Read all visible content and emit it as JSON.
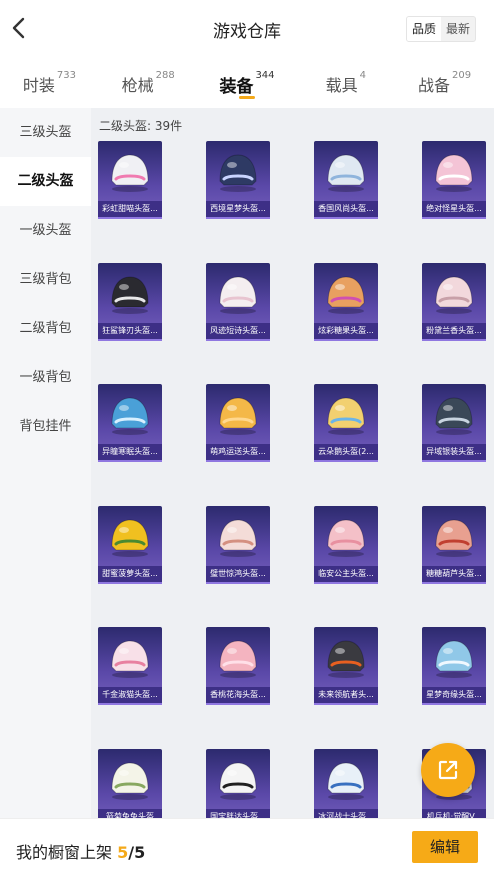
{
  "header": {
    "title": "游戏仓库",
    "sort_options": [
      "品质",
      "最新"
    ],
    "sort_active": 0
  },
  "tabs": [
    {
      "label": "时装",
      "count": "733"
    },
    {
      "label": "枪械",
      "count": "288"
    },
    {
      "label": "装备",
      "count": "344",
      "active": true
    },
    {
      "label": "载具",
      "count": "4"
    },
    {
      "label": "战备",
      "count": "209"
    }
  ],
  "sidebar": {
    "items": [
      "三级头盔",
      "二级头盔",
      "一级头盔",
      "三级背包",
      "二级背包",
      "一级背包",
      "背包挂件"
    ],
    "active": 1
  },
  "main": {
    "count_label": "二级头盔: 39件"
  },
  "items": [
    {
      "label": "彩虹甜喵头盔...",
      "color": "#f0f0f4",
      "accent": "#f07ab0"
    },
    {
      "label": "西境星梦头盔...",
      "color": "#2e3a64",
      "accent": "#c9d4ff"
    },
    {
      "label": "香国风尚头盔...",
      "color": "#dfe8f2",
      "accent": "#8fb4dc"
    },
    {
      "label": "绝对怪星头盔...",
      "color": "#f4c4d6",
      "accent": "#ffffff"
    },
    {
      "label": "狂鲨锋刃头盔...",
      "color": "#2a2a30",
      "accent": "#e8e8ea"
    },
    {
      "label": "风迹短诗头盔...",
      "color": "#f4eef0",
      "accent": "#e8c4d0"
    },
    {
      "label": "炫彩糖果头盔...",
      "color": "#e8a060",
      "accent": "#d04fb0"
    },
    {
      "label": "粉黛兰香头盔...",
      "color": "#f2d8dc",
      "accent": "#c8a0a8"
    },
    {
      "label": "异瞳寒眠头盔...",
      "color": "#4aa0d8",
      "accent": "#d8f0ff"
    },
    {
      "label": "萌鸡运送头盔...",
      "color": "#f4b848",
      "accent": "#ffd890"
    },
    {
      "label": "云朵鹅头盔(2...",
      "color": "#f2d070",
      "accent": "#6ab4e8"
    },
    {
      "label": "异域银装头盔...",
      "color": "#3a4858",
      "accent": "#c8d4e0"
    },
    {
      "label": "甜蜜菠萝头盔...",
      "color": "#f0c020",
      "accent": "#4a8a30"
    },
    {
      "label": "璧世惊鸿头盔...",
      "color": "#f4dcd8",
      "accent": "#d49080"
    },
    {
      "label": "临安公主头盔...",
      "color": "#f4c0c8",
      "accent": "#e890a0"
    },
    {
      "label": "糖糖葫芦头盔...",
      "color": "#e8a090",
      "accent": "#c04030"
    },
    {
      "label": "千金淑猫头盔...",
      "color": "#f8e0e8",
      "accent": "#e880a0"
    },
    {
      "label": "香桃花海头盔...",
      "color": "#f4b4c0",
      "accent": "#ffe0e8"
    },
    {
      "label": "未来领航者头...",
      "color": "#3a3a40",
      "accent": "#e86020"
    },
    {
      "label": "星梦奇缘头盔...",
      "color": "#90c8e8",
      "accent": "#f0f8ff"
    },
    {
      "label": "箭菊兔兔头盔",
      "color": "#f4f4e8",
      "accent": "#88a860"
    },
    {
      "label": "国宝胖达头盔...",
      "color": "#f4f4f4",
      "accent": "#202020"
    },
    {
      "label": "冰河战士头盔...",
      "color": "#e8f0f8",
      "accent": "#3870c0"
    },
    {
      "label": "机兵机·觉醒V...",
      "color": "#d0d4dc",
      "accent": "#606878"
    }
  ],
  "bottom": {
    "prefix": "我的橱窗上架",
    "current": "5",
    "sep_total": "/5",
    "edit_label": "编辑"
  },
  "colors": {
    "accent": "#f6aa17",
    "card_bg": "#3d2f86"
  }
}
